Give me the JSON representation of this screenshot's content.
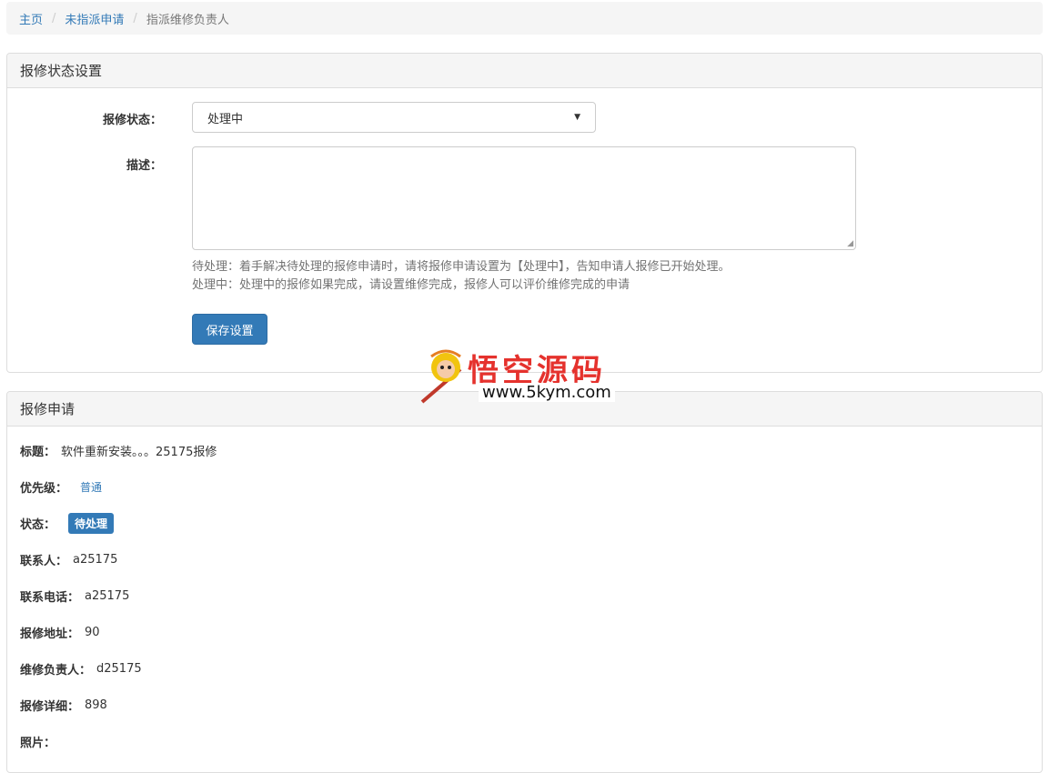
{
  "breadcrumb": {
    "home": "主页",
    "unassigned": "未指派申请",
    "current": "指派维修负责人",
    "separator": "/"
  },
  "status_panel": {
    "title": "报修状态设置",
    "status_label": "报修状态：",
    "status_value": "处理中",
    "desc_label": "描述：",
    "desc_value": "",
    "help_line1": "待处理：着手解决待处理的报修申请时，请将报修申请设置为【处理中】，告知申请人报修已开始处理。",
    "help_line2": "处理中：处理中的报修如果完成，请设置维修完成，报修人可以评价维修完成的申请",
    "save_label": "保存设置"
  },
  "request_panel": {
    "title": "报修申请",
    "rows": {
      "title_k": "标题：",
      "title_v": "软件重新安装。。。25175报修",
      "priority_k": "优先级：",
      "priority_v": "普通",
      "status_k": "状态：",
      "status_v": "待处理",
      "contact_k": "联系人：",
      "contact_v": "a25175",
      "phone_k": "联系电话：",
      "phone_v": "a25175",
      "address_k": "报修地址：",
      "address_v": "90",
      "owner_k": "维修负责人：",
      "owner_v": "d25175",
      "detail_k": "报修详细：",
      "detail_v": "898",
      "photo_k": "照片："
    }
  },
  "watermark": {
    "title": "悟空源码",
    "url": "www.5kym.com"
  },
  "colors": {
    "primary": "#337ab7",
    "panel_bg": "#f5f5f5",
    "border": "#dddddd",
    "watermark_red": "#e5322d"
  }
}
